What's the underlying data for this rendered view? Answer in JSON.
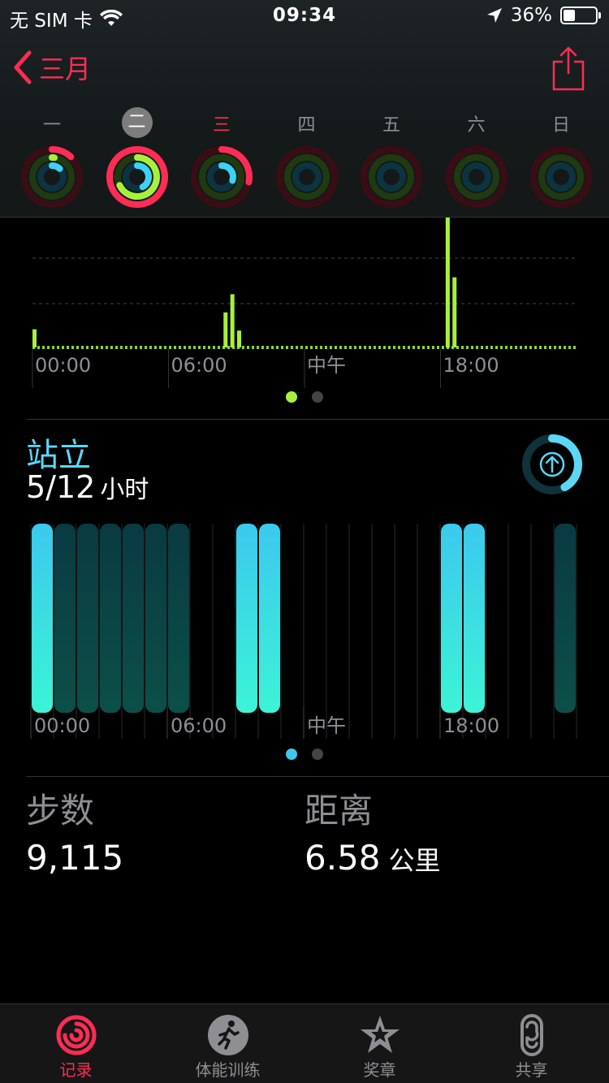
{
  "status_bar": {
    "carrier": "无 SIM 卡",
    "time": "09:34",
    "battery_percent": "36%",
    "battery_level": 0.36
  },
  "nav": {
    "back_label": "三月",
    "back_icon": "chevron-left-icon",
    "share_icon": "share-icon"
  },
  "week": {
    "days": [
      {
        "label": "一",
        "state": "normal",
        "move": 0.12,
        "exercise": 0.02,
        "stand": 0.12
      },
      {
        "label": "二",
        "state": "selected",
        "move": 1.0,
        "exercise": 0.68,
        "stand": 0.42
      },
      {
        "label": "三",
        "state": "today",
        "move": 0.28,
        "exercise": 0.0,
        "stand": 0.3
      },
      {
        "label": "四",
        "state": "normal",
        "move": 0,
        "exercise": 0,
        "stand": 0
      },
      {
        "label": "五",
        "state": "normal",
        "move": 0,
        "exercise": 0,
        "stand": 0
      },
      {
        "label": "六",
        "state": "normal",
        "move": 0,
        "exercise": 0,
        "stand": 0
      },
      {
        "label": "日",
        "state": "normal",
        "move": 0,
        "exercise": 0,
        "stand": 0
      }
    ]
  },
  "chart_data": [
    {
      "type": "bar",
      "x_ticks": [
        "00:00",
        "06:00",
        "中午",
        "18:00"
      ],
      "x_range_hours": [
        0,
        24
      ],
      "bars": [
        {
          "hour": 0.0,
          "value": 0.14
        },
        {
          "hour": 8.5,
          "value": 0.27
        },
        {
          "hour": 8.8,
          "value": 0.41
        },
        {
          "hour": 9.1,
          "value": 0.13
        },
        {
          "hour": 18.3,
          "value": 1.0
        },
        {
          "hour": 18.6,
          "value": 0.54
        }
      ],
      "grid": true,
      "colors": {
        "bar": "#a6f23a",
        "baseline": "#8bd42a"
      },
      "pagination": {
        "count": 2,
        "active": 0
      }
    },
    {
      "type": "bar",
      "x_ticks": [
        "00:00",
        "06:00",
        "中午",
        "18:00"
      ],
      "hours": 24,
      "stood": [
        1,
        0,
        0,
        0,
        0,
        0,
        0,
        0,
        0,
        1,
        1,
        0,
        0,
        0,
        0,
        0,
        0,
        0,
        1,
        1,
        0,
        0,
        0,
        0
      ],
      "recorded": [
        1,
        1,
        1,
        1,
        1,
        1,
        1,
        0,
        0,
        1,
        1,
        0,
        0,
        0,
        0,
        0,
        0,
        0,
        1,
        1,
        0,
        0,
        0,
        1
      ],
      "colors": {
        "stood_top": "#3cc8ee",
        "stood_bottom": "#3cf4d6",
        "inactive": "#0a3a42"
      },
      "pagination": {
        "count": 2,
        "active": 0
      }
    }
  ],
  "stand": {
    "title": "站立",
    "value": "5/12",
    "unit": "小时",
    "progress": 0.42,
    "icon": "arrow-up-icon",
    "color": "#5ad8f5"
  },
  "stats": {
    "steps": {
      "label": "步数",
      "value": "9,115"
    },
    "distance": {
      "label": "距离",
      "value": "6.58",
      "unit": "公里"
    }
  },
  "tabs": [
    {
      "label": "记录",
      "icon": "activity-rings-icon",
      "active": true
    },
    {
      "label": "体能训练",
      "icon": "running-figure-icon",
      "active": false
    },
    {
      "label": "奖章",
      "icon": "award-star-icon",
      "active": false
    },
    {
      "label": "共享",
      "icon": "sharing-icon",
      "active": false
    }
  ]
}
